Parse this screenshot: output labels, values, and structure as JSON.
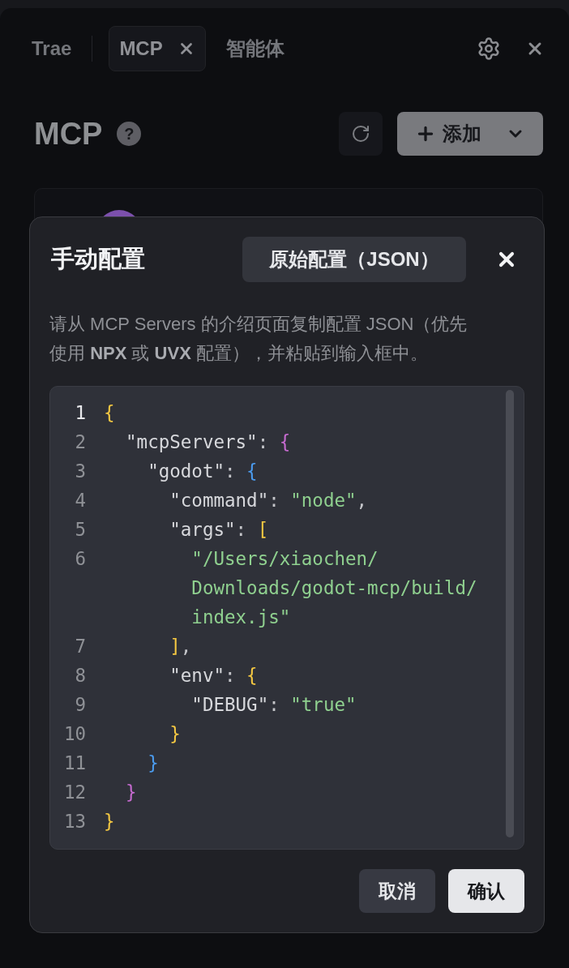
{
  "tabs": [
    {
      "label": "Trae",
      "selected": false
    },
    {
      "label": "MCP",
      "selected": true
    },
    {
      "label": "智能体",
      "selected": false
    }
  ],
  "header": {
    "title": "MCP",
    "help_icon": "?",
    "add_button": "添加"
  },
  "dialog": {
    "title": "手动配置",
    "mode_button": "原始配置（JSON）",
    "description": "请从 MCP Servers 的介绍页面复制配置 JSON（优先使用 **NPX** 或 **UVX** 配置），并粘贴到输入框中。",
    "code_lines": [
      {
        "number": "1",
        "selected": true,
        "tokens": [
          {
            "kind": "bracket",
            "text": "{",
            "color": "#f5c842"
          }
        ]
      },
      {
        "number": "2",
        "selected": false,
        "tokens": [
          {
            "kind": "key",
            "text": "\"mcpServers\""
          },
          {
            "kind": "punct",
            "text": ": "
          },
          {
            "kind": "bracket",
            "text": "{",
            "color": "#c76bd1"
          }
        ]
      },
      {
        "number": "3",
        "selected": false,
        "tokens": [
          {
            "kind": "key",
            "text": "\"godot\""
          },
          {
            "kind": "punct",
            "text": ": "
          },
          {
            "kind": "bracket",
            "text": "{",
            "color": "#4b9cf0"
          }
        ]
      },
      {
        "number": "4",
        "selected": false,
        "tokens": [
          {
            "kind": "key",
            "text": "\"command\""
          },
          {
            "kind": "punct",
            "text": ": "
          },
          {
            "kind": "string",
            "text": "\"node\""
          },
          {
            "kind": "punct",
            "text": ","
          }
        ]
      },
      {
        "number": "5",
        "selected": false,
        "tokens": [
          {
            "kind": "key",
            "text": "\"args\""
          },
          {
            "kind": "punct",
            "text": ": "
          },
          {
            "kind": "bracket",
            "text": "[",
            "color": "#f5c842"
          }
        ]
      },
      {
        "number": "6",
        "selected": false,
        "tokens": [
          {
            "kind": "string",
            "text": "\"/Users/xiaochen/\nDownloads/godot-mcp/build/\nindex.js\""
          }
        ]
      },
      {
        "number": "7",
        "selected": false,
        "tokens": [
          {
            "kind": "bracket",
            "text": "]",
            "color": "#f5c842"
          },
          {
            "kind": "punct",
            "text": ","
          }
        ]
      },
      {
        "number": "8",
        "selected": false,
        "tokens": [
          {
            "kind": "key",
            "text": "\"env\""
          },
          {
            "kind": "punct",
            "text": ": "
          },
          {
            "kind": "bracket",
            "text": "{",
            "color": "#f5c842"
          }
        ]
      },
      {
        "number": "9",
        "selected": false,
        "tokens": [
          {
            "kind": "key",
            "text": "\"DEBUG\""
          },
          {
            "kind": "punct",
            "text": ": "
          },
          {
            "kind": "string",
            "text": "\"true\""
          }
        ]
      },
      {
        "number": "10",
        "selected": false,
        "tokens": [
          {
            "kind": "bracket",
            "text": "}",
            "color": "#f5c842"
          }
        ]
      },
      {
        "number": "11",
        "selected": false,
        "tokens": [
          {
            "kind": "bracket",
            "text": "}",
            "color": "#4b9cf0"
          }
        ]
      },
      {
        "number": "12",
        "selected": false,
        "tokens": [
          {
            "kind": "bracket",
            "text": "}",
            "color": "#c76bd1"
          }
        ]
      },
      {
        "number": "13",
        "selected": false,
        "tokens": [
          {
            "kind": "bracket",
            "text": "}",
            "color": "#f5c842"
          }
        ]
      }
    ],
    "cancel_button": "取消",
    "confirm_button": "确认"
  }
}
